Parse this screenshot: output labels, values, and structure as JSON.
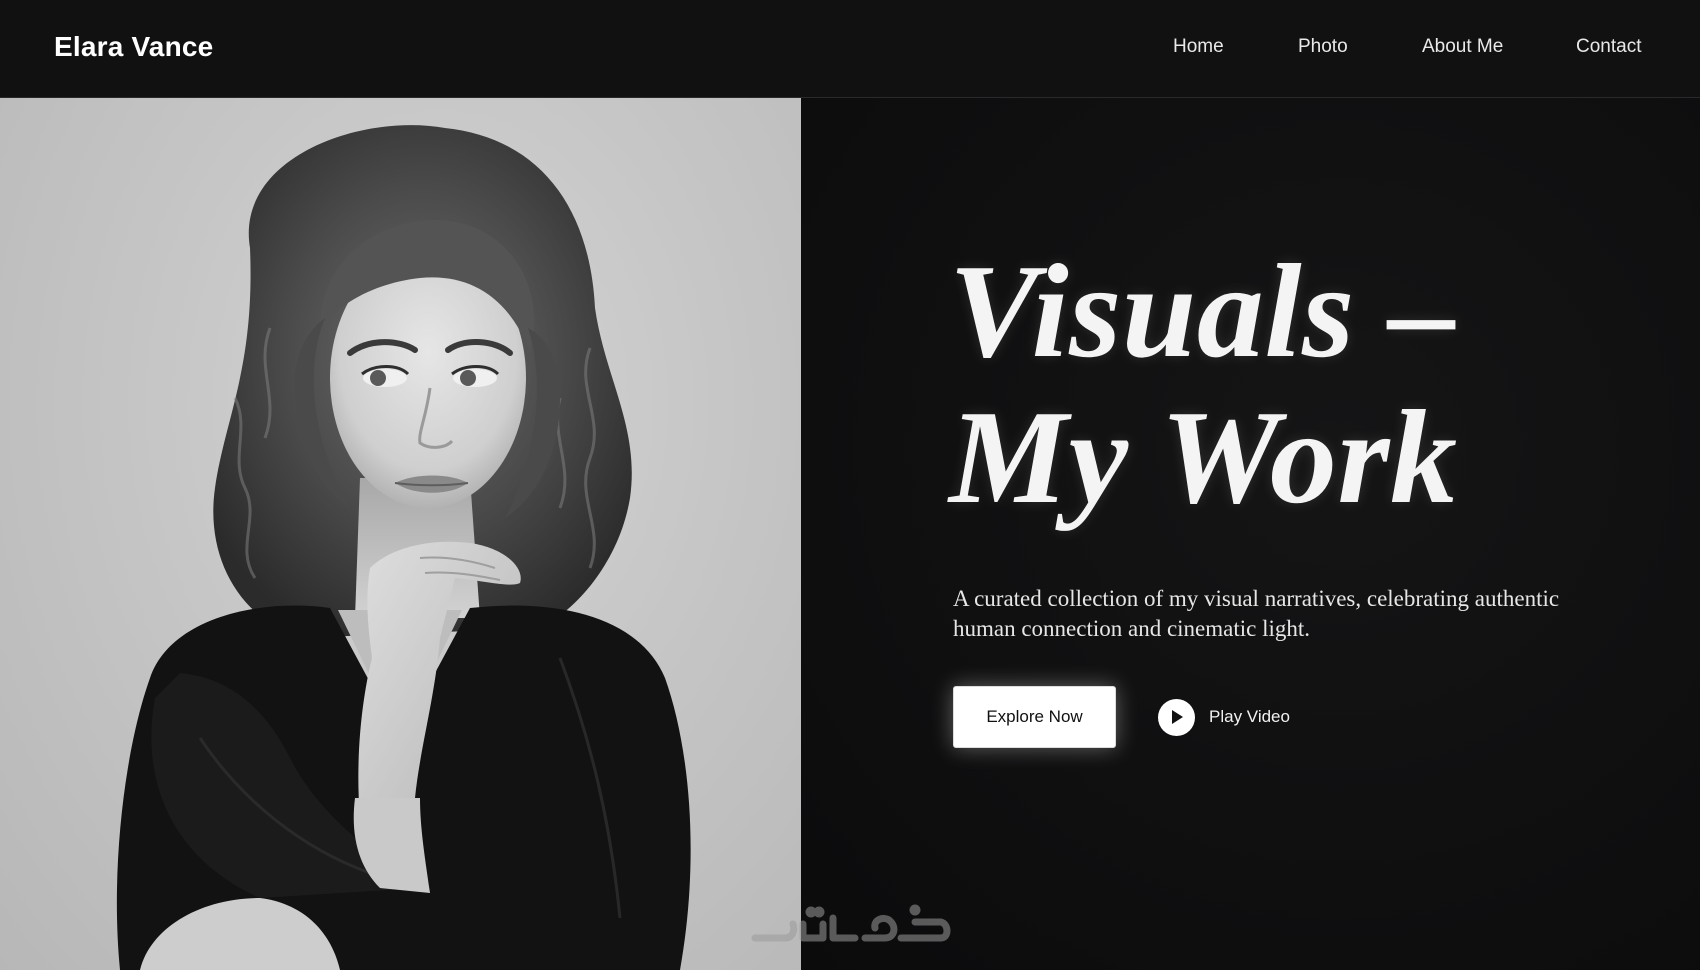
{
  "header": {
    "brand": "Elara Vance",
    "nav": [
      {
        "label": "Home"
      },
      {
        "label": "Photo"
      },
      {
        "label": "About Me"
      },
      {
        "label": "Contact"
      }
    ]
  },
  "hero": {
    "headline_line1": "Visuals –",
    "headline_line2": "My Work",
    "subtitle_line1": "A curated collection of my visual narratives, celebrating authentic",
    "subtitle_line2": "human connection and cinematic light.",
    "explore_label": "Explore Now",
    "play_label": "Play Video",
    "play_icon": "play-icon"
  },
  "watermark": {
    "text": "خمسات"
  },
  "colors": {
    "background": "#0e0e0f",
    "navbar": "#111112",
    "text": "#ffffff",
    "button": "#ffffff"
  }
}
